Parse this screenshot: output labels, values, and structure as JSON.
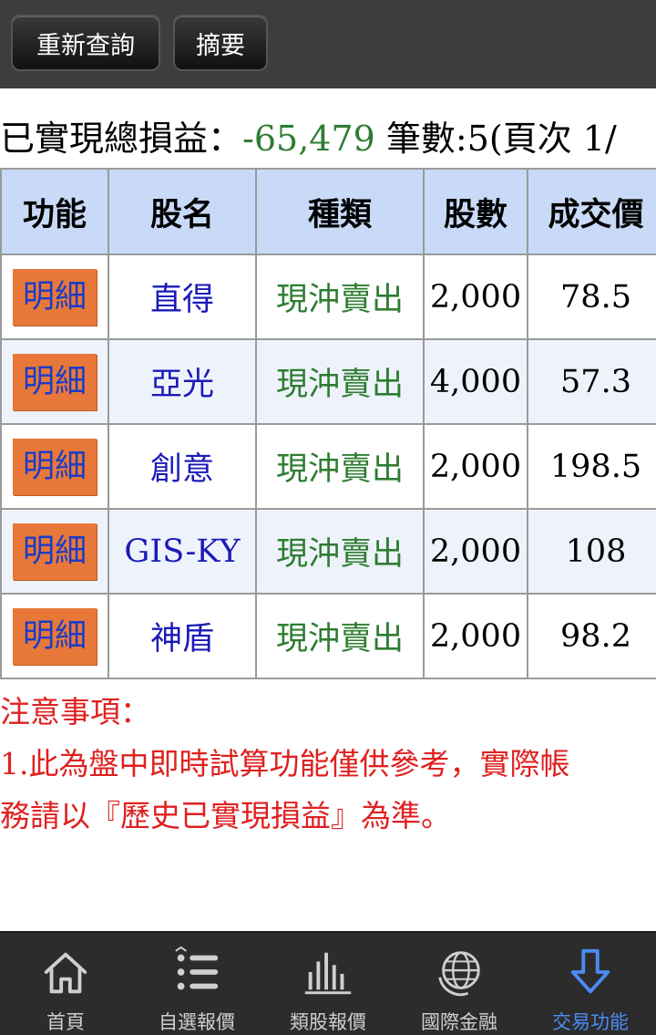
{
  "toolbar": {
    "requery_label": "重新查詢",
    "summary_label": "摘要"
  },
  "summary": {
    "label": "已實現總損益：",
    "value": "-65,479",
    "count_text": " 筆數:5(頁次 1/"
  },
  "table": {
    "headers": [
      "功能",
      "股名",
      "種類",
      "股數",
      "成交價"
    ],
    "rows": [
      {
        "action": "明細",
        "name": "直得",
        "kind": "現沖賣出",
        "shares": "2,000",
        "price": "78.5"
      },
      {
        "action": "明細",
        "name": "亞光",
        "kind": "現沖賣出",
        "shares": "4,000",
        "price": "57.3"
      },
      {
        "action": "明細",
        "name": "創意",
        "kind": "現沖賣出",
        "shares": "2,000",
        "price": "198.5"
      },
      {
        "action": "明細",
        "name": "GIS-KY",
        "kind": "現沖賣出",
        "shares": "2,000",
        "price": "108"
      },
      {
        "action": "明細",
        "name": "神盾",
        "kind": "現沖賣出",
        "shares": "2,000",
        "price": "98.2"
      }
    ]
  },
  "notes": {
    "title": "注意事項：",
    "line1_num": "1.",
    "line1": "此為盤中即時試算功能僅供參考，實際帳",
    "line2": "務請以『歷史已實現損益』為準。"
  },
  "nav": {
    "items": [
      {
        "label": "首頁",
        "icon": "home-icon"
      },
      {
        "label": "自選報價",
        "icon": "list-icon"
      },
      {
        "label": "類股報價",
        "icon": "bar-chart-icon"
      },
      {
        "label": "國際金融",
        "icon": "globe-icon"
      },
      {
        "label": "交易功能",
        "icon": "down-arrow-icon"
      }
    ],
    "active_color": "#4a8cf5"
  }
}
